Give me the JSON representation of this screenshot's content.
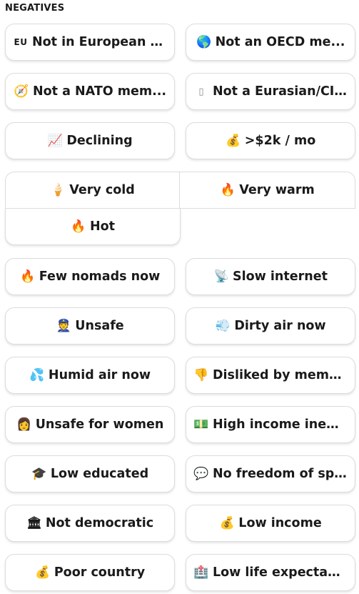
{
  "section": {
    "title": "NEGATIVES"
  },
  "chips": {
    "not_eu": {
      "icon": "EU",
      "label": "Not in European U..."
    },
    "not_oecd": {
      "icon": "🌎",
      "label": "Not an OECD me..."
    },
    "not_nato": {
      "icon": "🧭",
      "label": "Not a NATO mem..."
    },
    "not_eurasian": {
      "icon": "▯",
      "label": "Not a Eurasian/CIS..."
    },
    "declining": {
      "icon": "📈",
      "label": "Declining"
    },
    "cost": {
      "icon": "💰",
      "label": ">$2k / mo"
    },
    "very_cold": {
      "icon": "🍦",
      "label": "Very cold"
    },
    "very_warm": {
      "icon": "🔥",
      "label": "Very warm"
    },
    "hot": {
      "icon": "🔥",
      "label": "Hot"
    },
    "few_nomads": {
      "icon": "🔥",
      "label": "Few nomads now"
    },
    "slow_internet": {
      "icon": "📡",
      "label": "Slow internet"
    },
    "unsafe": {
      "icon": "👮",
      "label": "Unsafe"
    },
    "dirty_air": {
      "icon": "💨",
      "label": "Dirty air now"
    },
    "humid_air": {
      "icon": "💦",
      "label": "Humid air now"
    },
    "disliked": {
      "icon": "👎",
      "label": "Disliked by memb..."
    },
    "unsafe_women": {
      "icon": "👩",
      "label": "Unsafe for women"
    },
    "income_ineq": {
      "icon": "💵",
      "label": "High income ineq..."
    },
    "low_educated": {
      "icon": "🎓",
      "label": "Low educated"
    },
    "no_freedom": {
      "icon": "💬",
      "label": "No freedom of sp..."
    },
    "not_democratic": {
      "icon": "🏛",
      "label": "Not democratic"
    },
    "low_income": {
      "icon": "💰",
      "label": "Low income"
    },
    "poor_country": {
      "icon": "💰",
      "label": "Poor country"
    },
    "low_life_exp": {
      "icon": "🏥",
      "label": "Low life expectan..."
    }
  }
}
